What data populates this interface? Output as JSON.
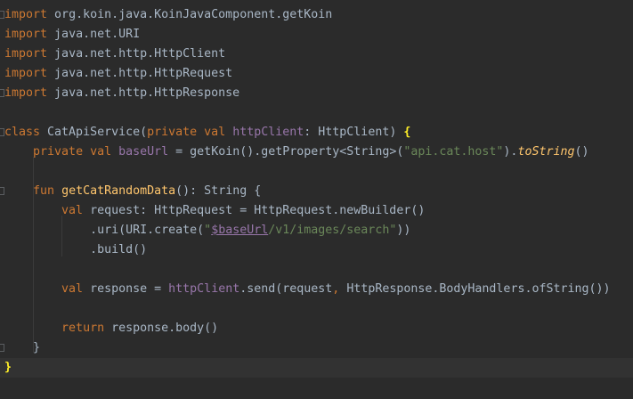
{
  "editor": {
    "colors": {
      "background": "#2b2b2b",
      "current_line": "#323232",
      "keyword": "#cc7832",
      "function": "#ffc66d",
      "property": "#9876aa",
      "string": "#6a8759",
      "text": "#a9b7c6",
      "brace_match": "#ffef28"
    },
    "lines": {
      "l1": {
        "kw": "import",
        "rest": " org.koin.java.KoinJavaComponent.getKoin"
      },
      "l2": {
        "kw": "import",
        "rest": " java.net.URI"
      },
      "l3": {
        "kw": "import",
        "rest": " java.net.http.HttpClient"
      },
      "l4": {
        "kw": "import",
        "rest": " java.net.http.HttpRequest"
      },
      "l5": {
        "kw": "import",
        "rest": " java.net.http.HttpResponse"
      },
      "l7": {
        "kw_class": "class",
        "class_name": " CatApiService(",
        "kw_private": "private",
        "kw_val": " val",
        "prop": " httpClient",
        "type": ": HttpClient) ",
        "brace": "{"
      },
      "l8": {
        "indent": "    ",
        "kw_private": "private",
        "kw_val": " val",
        "prop": " baseUrl",
        "eq": " = getKoin().getProperty<String>(",
        "str": "\"api.cat.host\"",
        "close": ").",
        "ext": "toString",
        "end": "()"
      },
      "l10": {
        "indent": "    ",
        "kw_fun": "fun",
        "fn": " getCatRandomData",
        "rest": "(): String {"
      },
      "l11": {
        "indent": "        ",
        "kw_val": "val",
        "rest": " request: HttpRequest = HttpRequest.newBuilder()"
      },
      "l12": {
        "indent": "            ",
        "pre": ".uri(URI.create(",
        "q1": "\"",
        "tmpl": "$baseUrl",
        "path": "/v1/images/search",
        "q2": "\"",
        "end": "))"
      },
      "l13": {
        "indent": "            ",
        "text": ".build()"
      },
      "l15": {
        "indent": "        ",
        "kw_val": "val",
        "mid": " response = ",
        "prop": "httpClient",
        "send": ".send(request",
        "comma": ",",
        "rest": " HttpResponse.BodyHandlers.ofString())"
      },
      "l17": {
        "indent": "        ",
        "kw_return": "return",
        "rest": " response.body()"
      },
      "l18": {
        "indent": "    ",
        "text": "}"
      },
      "l19": {
        "text": "}"
      }
    }
  }
}
